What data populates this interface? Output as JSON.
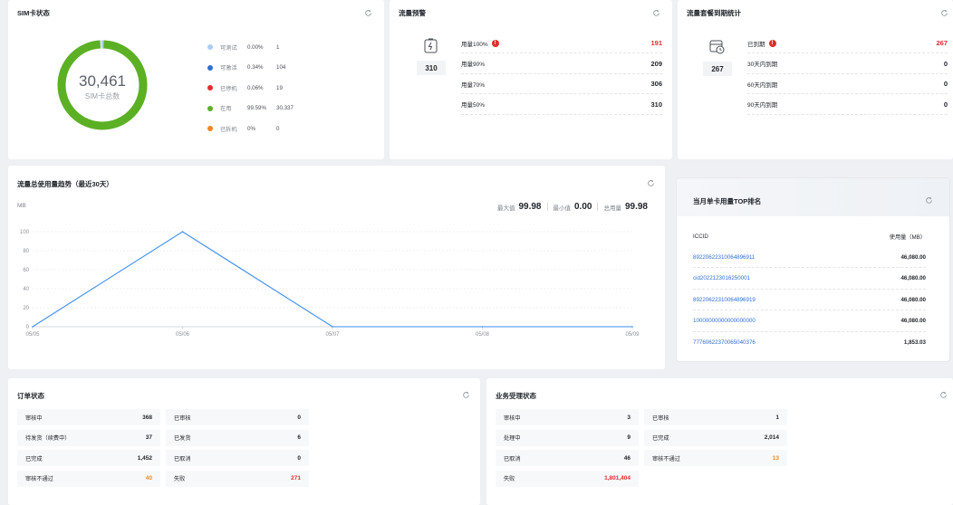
{
  "sim_status": {
    "title": "SIM卡状态",
    "total": "30,461",
    "total_label": "SIM卡总数",
    "legend": [
      {
        "label": "可测试",
        "pct": "0.00%",
        "count": "1",
        "color": "#a9cdf3"
      },
      {
        "label": "可激活",
        "pct": "0.34%",
        "count": "104",
        "color": "#2f6fd6"
      },
      {
        "label": "已停机",
        "pct": "0.06%",
        "count": "19",
        "color": "#e02d2d"
      },
      {
        "label": "在用",
        "pct": "99.59%",
        "count": "30,337",
        "color": "#5cb024"
      },
      {
        "label": "已拆机",
        "pct": "0%",
        "count": "0",
        "color": "#f5871f"
      }
    ],
    "ring_color": "#5cb024"
  },
  "traffic_alert": {
    "title": "流量预警",
    "total": "310",
    "rows": [
      {
        "label": "用量100%",
        "value": "191",
        "alert": true,
        "badge": "!"
      },
      {
        "label": "用量90%",
        "value": "209",
        "alert": false
      },
      {
        "label": "用量70%",
        "value": "306",
        "alert": false
      },
      {
        "label": "用量50%",
        "value": "310",
        "alert": false
      }
    ]
  },
  "expiry": {
    "title": "流量套餐到期统计",
    "total": "267",
    "rows": [
      {
        "label": "已到期",
        "value": "267",
        "alert": true,
        "badge": "!"
      },
      {
        "label": "30天内到期",
        "value": "0",
        "alert": false
      },
      {
        "label": "60天内到期",
        "value": "0",
        "alert": false
      },
      {
        "label": "90天内到期",
        "value": "0",
        "alert": false
      }
    ]
  },
  "trend": {
    "title": "流量总使用量趋势（最近30天）",
    "unit": "MB",
    "stats": [
      {
        "label": "最大值",
        "value": "99.98"
      },
      {
        "label": "最小值",
        "value": "0.00"
      },
      {
        "label": "总用量",
        "value": "99.98"
      }
    ]
  },
  "chart_data": {
    "type": "line",
    "x": [
      "05/05",
      "05/06",
      "05/07",
      "05/08",
      "05/09"
    ],
    "series": [
      {
        "values": [
          0,
          99.98,
          0,
          0,
          0
        ]
      }
    ],
    "yticks": [
      "0",
      "20",
      "40",
      "60",
      "80",
      "100"
    ],
    "ylim": [
      0,
      100
    ],
    "xlabel": "",
    "ylabel": "MB",
    "grid": true,
    "color": "#3d8ef0"
  },
  "top_rank": {
    "title": "当月单卡用量TOP排名",
    "col_iccid": "ICCID",
    "col_usage": "使用量（MB）",
    "rows": [
      {
        "iccid": "89220622310064896911",
        "usage": "46,080.00"
      },
      {
        "iccid": "cid2022123016250001",
        "usage": "46,080.00"
      },
      {
        "iccid": "89220622310064896919",
        "usage": "46,080.00"
      },
      {
        "iccid": "10000000000000000000",
        "usage": "46,080.00"
      },
      {
        "iccid": "77760622370065040376",
        "usage": "1,853.03"
      }
    ]
  },
  "orders": {
    "title": "订单状态",
    "left": [
      {
        "label": "审核中",
        "value": "368",
        "color": ""
      },
      {
        "label": "待发货（续费中）",
        "value": "37",
        "color": ""
      },
      {
        "label": "已完成",
        "value": "1,452",
        "color": ""
      },
      {
        "label": "审核不通过",
        "value": "40",
        "color": "orange"
      }
    ],
    "right": [
      {
        "label": "已审核",
        "value": "0",
        "color": ""
      },
      {
        "label": "已发货",
        "value": "6",
        "color": ""
      },
      {
        "label": "已取消",
        "value": "0",
        "color": ""
      },
      {
        "label": "失败",
        "value": "271",
        "color": "red"
      }
    ]
  },
  "business": {
    "title": "业务受理状态",
    "left": [
      {
        "label": "审核中",
        "value": "3",
        "color": ""
      },
      {
        "label": "处理中",
        "value": "9",
        "color": ""
      },
      {
        "label": "已取消",
        "value": "46",
        "color": ""
      },
      {
        "label": "失败",
        "value": "1,801,404",
        "color": "red"
      }
    ],
    "right": [
      {
        "label": "已审核",
        "value": "1",
        "color": ""
      },
      {
        "label": "已完成",
        "value": "2,014",
        "color": ""
      },
      {
        "label": "审核不通过",
        "value": "13",
        "color": "orange"
      }
    ]
  }
}
